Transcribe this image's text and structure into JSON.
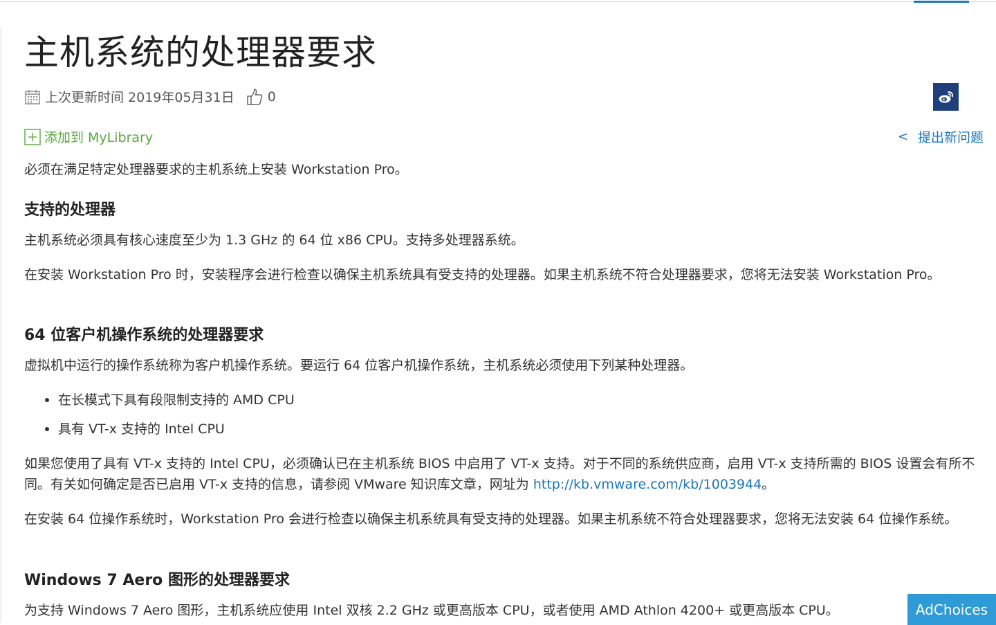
{
  "article": {
    "title": "主机系统的处理器要求",
    "updated_label": "上次更新时间",
    "updated_date": "2019年05月31日",
    "likes": "0",
    "add_to_library": "添加到 MyLibrary",
    "feedback": "提出新问题",
    "feedback_chevron": "<",
    "intro": "必须在满足特定处理器要求的主机系统上安装 Workstation Pro。",
    "sections": [
      {
        "heading": "支持的处理器",
        "paragraphs": [
          "主机系统必须具有核心速度至少为 1.3 GHz 的 64 位 x86 CPU。支持多处理器系统。",
          "在安装 Workstation Pro 时，安装程序会进行检查以确保主机系统具有受支持的处理器。如果主机系统不符合处理器要求，您将无法安装 Workstation Pro。"
        ]
      },
      {
        "heading": "64 位客户机操作系统的处理器要求",
        "intro": "虚拟机中运行的操作系统称为客户机操作系统。要运行 64 位客户机操作系统，主机系统必须使用下列某种处理器。",
        "bullets": [
          "在长模式下具有段限制支持的 AMD CPU",
          "具有 VT-x 支持的 Intel CPU"
        ],
        "vtx_text": "如果您使用了具有 VT-x 支持的 Intel CPU，必须确认已在主机系统 BIOS 中启用了 VT-x 支持。对于不同的系统供应商，启用 VT-x 支持所需的 BIOS 设置会有所不同。有关如何确定是否已启用 VT-x 支持的信息，请参阅 VMware 知识库文章，网址为 ",
        "vtx_link": "http://kb.vmware.com/kb/1003944",
        "vtx_end": "。",
        "install_text": "在安装 64 位操作系统时，Workstation Pro 会进行检查以确保主机系统具有受支持的处理器。如果主机系统不符合处理器要求，您将无法安装 64 位操作系统。"
      },
      {
        "heading": "Windows 7 Aero 图形的处理器要求",
        "paragraph": "为支持 Windows 7 Aero 图形，主机系统应使用 Intel 双核 2.2 GHz 或更高版本 CPU，或者使用 AMD Athlon 4200+ 或更高版本 CPU。"
      }
    ]
  },
  "ad": {
    "label": "AdChoices"
  },
  "colors": {
    "link": "#1b75bb",
    "library_green": "#5aa73f",
    "weibo_bg": "#1f3f7a",
    "adchoices_bg": "#2e9ad6"
  },
  "icons": {
    "calendar": "calendar-icon",
    "like": "thumbs-up-icon",
    "weibo": "weibo-icon",
    "add": "plus-box-icon"
  }
}
